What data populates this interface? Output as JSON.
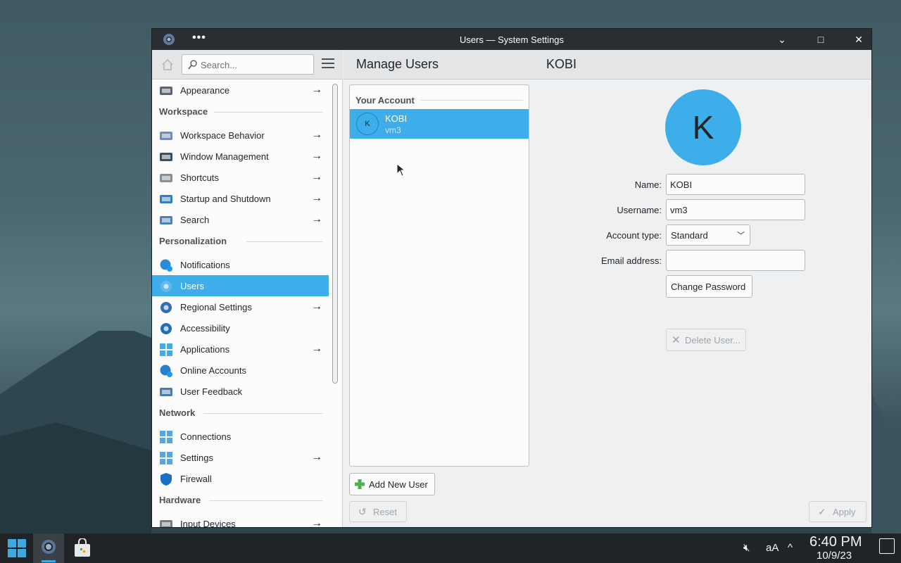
{
  "window": {
    "title": "Users — System Settings",
    "menu_dots": "•••",
    "minimize": "⌄",
    "maximize": "□",
    "close": "✕"
  },
  "sidebar": {
    "search_placeholder": "Search...",
    "items": [
      {
        "label": "Appearance",
        "has_arrow": true,
        "icon": "appearance-icon"
      },
      {
        "category": "Workspace"
      },
      {
        "label": "Workspace Behavior",
        "has_arrow": true,
        "icon": "workspace-behavior-icon"
      },
      {
        "label": "Window Management",
        "has_arrow": true,
        "icon": "window-management-icon"
      },
      {
        "label": "Shortcuts",
        "has_arrow": true,
        "icon": "keyboard-icon"
      },
      {
        "label": "Startup and Shutdown",
        "has_arrow": true,
        "icon": "startup-icon"
      },
      {
        "label": "Search",
        "has_arrow": true,
        "icon": "search-settings-icon"
      },
      {
        "category": "Personalization"
      },
      {
        "label": "Notifications",
        "has_arrow": false,
        "icon": "notifications-icon"
      },
      {
        "label": "Users",
        "has_arrow": false,
        "icon": "users-icon",
        "active": true
      },
      {
        "label": "Regional Settings",
        "has_arrow": true,
        "icon": "regional-icon"
      },
      {
        "label": "Accessibility",
        "has_arrow": false,
        "icon": "accessibility-icon"
      },
      {
        "label": "Applications",
        "has_arrow": true,
        "icon": "applications-icon"
      },
      {
        "label": "Online Accounts",
        "has_arrow": false,
        "icon": "online-accounts-icon"
      },
      {
        "label": "User Feedback",
        "has_arrow": false,
        "icon": "user-feedback-icon"
      },
      {
        "category": "Network"
      },
      {
        "label": "Connections",
        "has_arrow": false,
        "icon": "connections-icon"
      },
      {
        "label": "Settings",
        "has_arrow": true,
        "icon": "network-settings-icon"
      },
      {
        "label": "Firewall",
        "has_arrow": false,
        "icon": "firewall-icon"
      },
      {
        "category": "Hardware"
      },
      {
        "label": "Input Devices",
        "has_arrow": true,
        "icon": "mouse-icon"
      }
    ]
  },
  "main": {
    "title": "Manage Users",
    "user_title": "KOBI",
    "your_account": "Your Account",
    "list_user_initial": "K",
    "list_user_name": "KOBI",
    "list_user_username": "vm3",
    "add_user": "Add New User",
    "reset": "Reset",
    "apply": "Apply",
    "avatar_letter": "K",
    "form": {
      "name_label": "Name:",
      "name_value": "KOBI",
      "username_label": "Username:",
      "username_value": "vm3",
      "account_type_label": "Account type:",
      "account_type_value": "Standard",
      "email_label": "Email address:",
      "email_value": "",
      "change_password": "Change Password",
      "delete_user": "Delete User..."
    }
  },
  "taskbar": {
    "time": "6:40 PM",
    "date": "10/9/23",
    "font_size_icon": "aA",
    "tray_up": "^"
  }
}
